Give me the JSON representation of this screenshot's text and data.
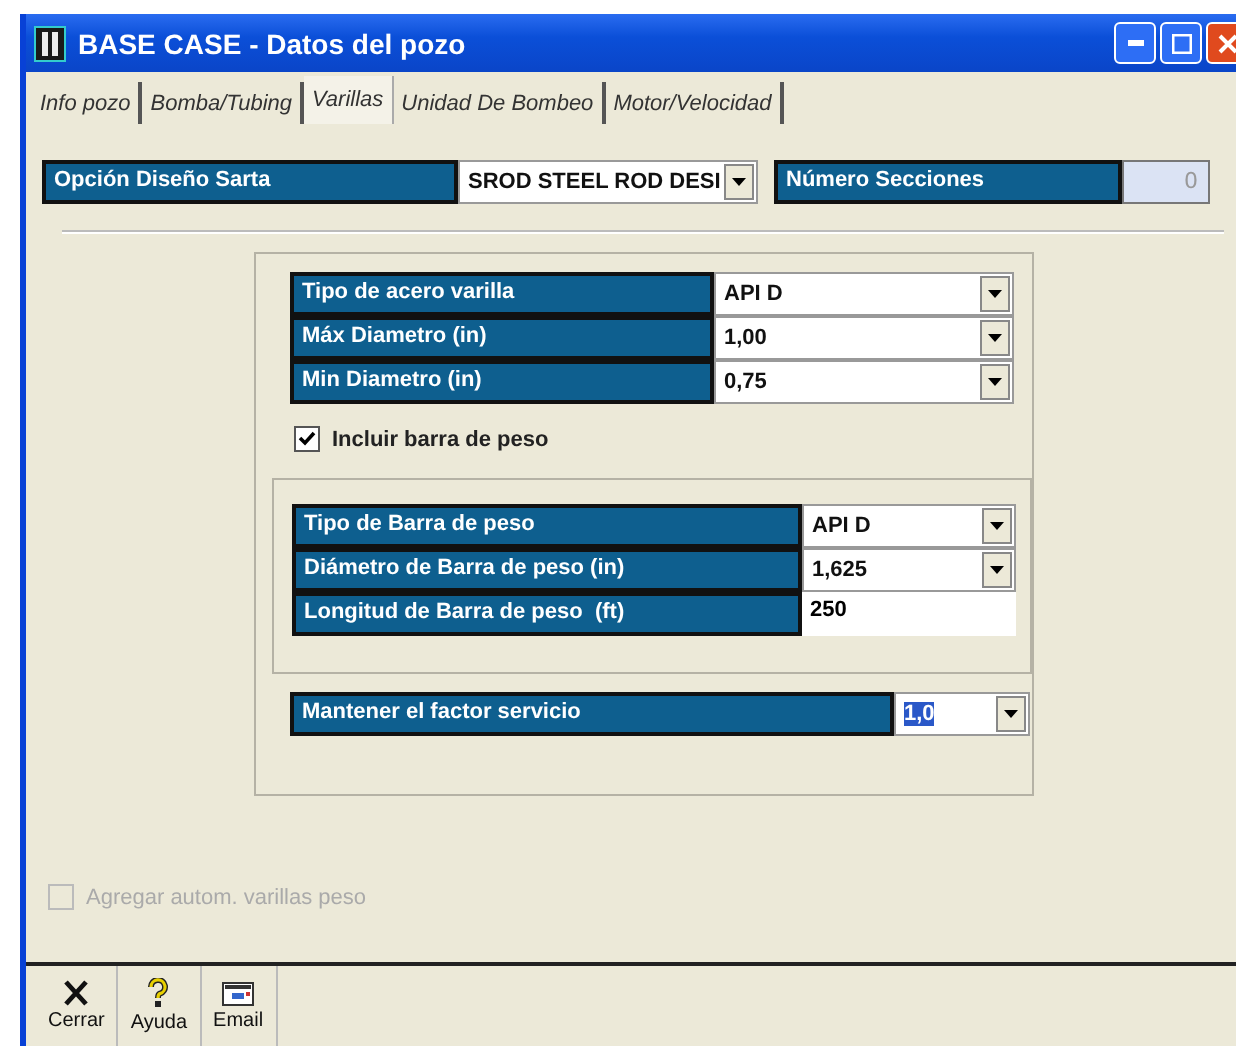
{
  "window": {
    "title": "BASE CASE - Datos del pozo"
  },
  "tabs": [
    {
      "label": "Info pozo",
      "selected": false
    },
    {
      "label": "Bomba/Tubing",
      "selected": false
    },
    {
      "label": "Varillas",
      "selected": true
    },
    {
      "label": "Unidad De Bombeo",
      "selected": false
    },
    {
      "label": "Motor/Velocidad",
      "selected": false
    }
  ],
  "design_option": {
    "label": "Opción Diseño Sarta",
    "value": "SROD STEEL ROD DESI"
  },
  "sections_count": {
    "label": "Número Secciones",
    "value": "0",
    "disabled": true
  },
  "rod_fields": [
    {
      "label": "Tipo de acero varilla",
      "value": "API D",
      "kind": "combo"
    },
    {
      "label": "Máx Diametro (in)",
      "value": "1,00",
      "kind": "combo"
    },
    {
      "label": "Min Diametro (in)",
      "value": "0,75",
      "kind": "combo"
    }
  ],
  "include_sinker": {
    "label": "Incluir barra de peso",
    "checked": true,
    "disabled": false
  },
  "sinker_fields": [
    {
      "label": "Tipo de Barra de peso",
      "value": "API D",
      "kind": "combo"
    },
    {
      "label": "Diámetro de Barra de peso (in)",
      "value": "1,625",
      "kind": "combo"
    },
    {
      "label": "Longitud de Barra de peso  (ft)",
      "value": "250",
      "kind": "text"
    }
  ],
  "service_factor": {
    "label": "Mantener el factor servicio",
    "value": "1,0",
    "kind": "combo",
    "highlighted": true
  },
  "auto_add": {
    "label": "Agregar autom. varillas peso",
    "checked": false,
    "disabled": true
  },
  "toolbar": [
    {
      "label": "Cerrar",
      "kind": "close"
    },
    {
      "label": "Ayuda",
      "kind": "help"
    },
    {
      "label": "Email",
      "kind": "email"
    }
  ]
}
